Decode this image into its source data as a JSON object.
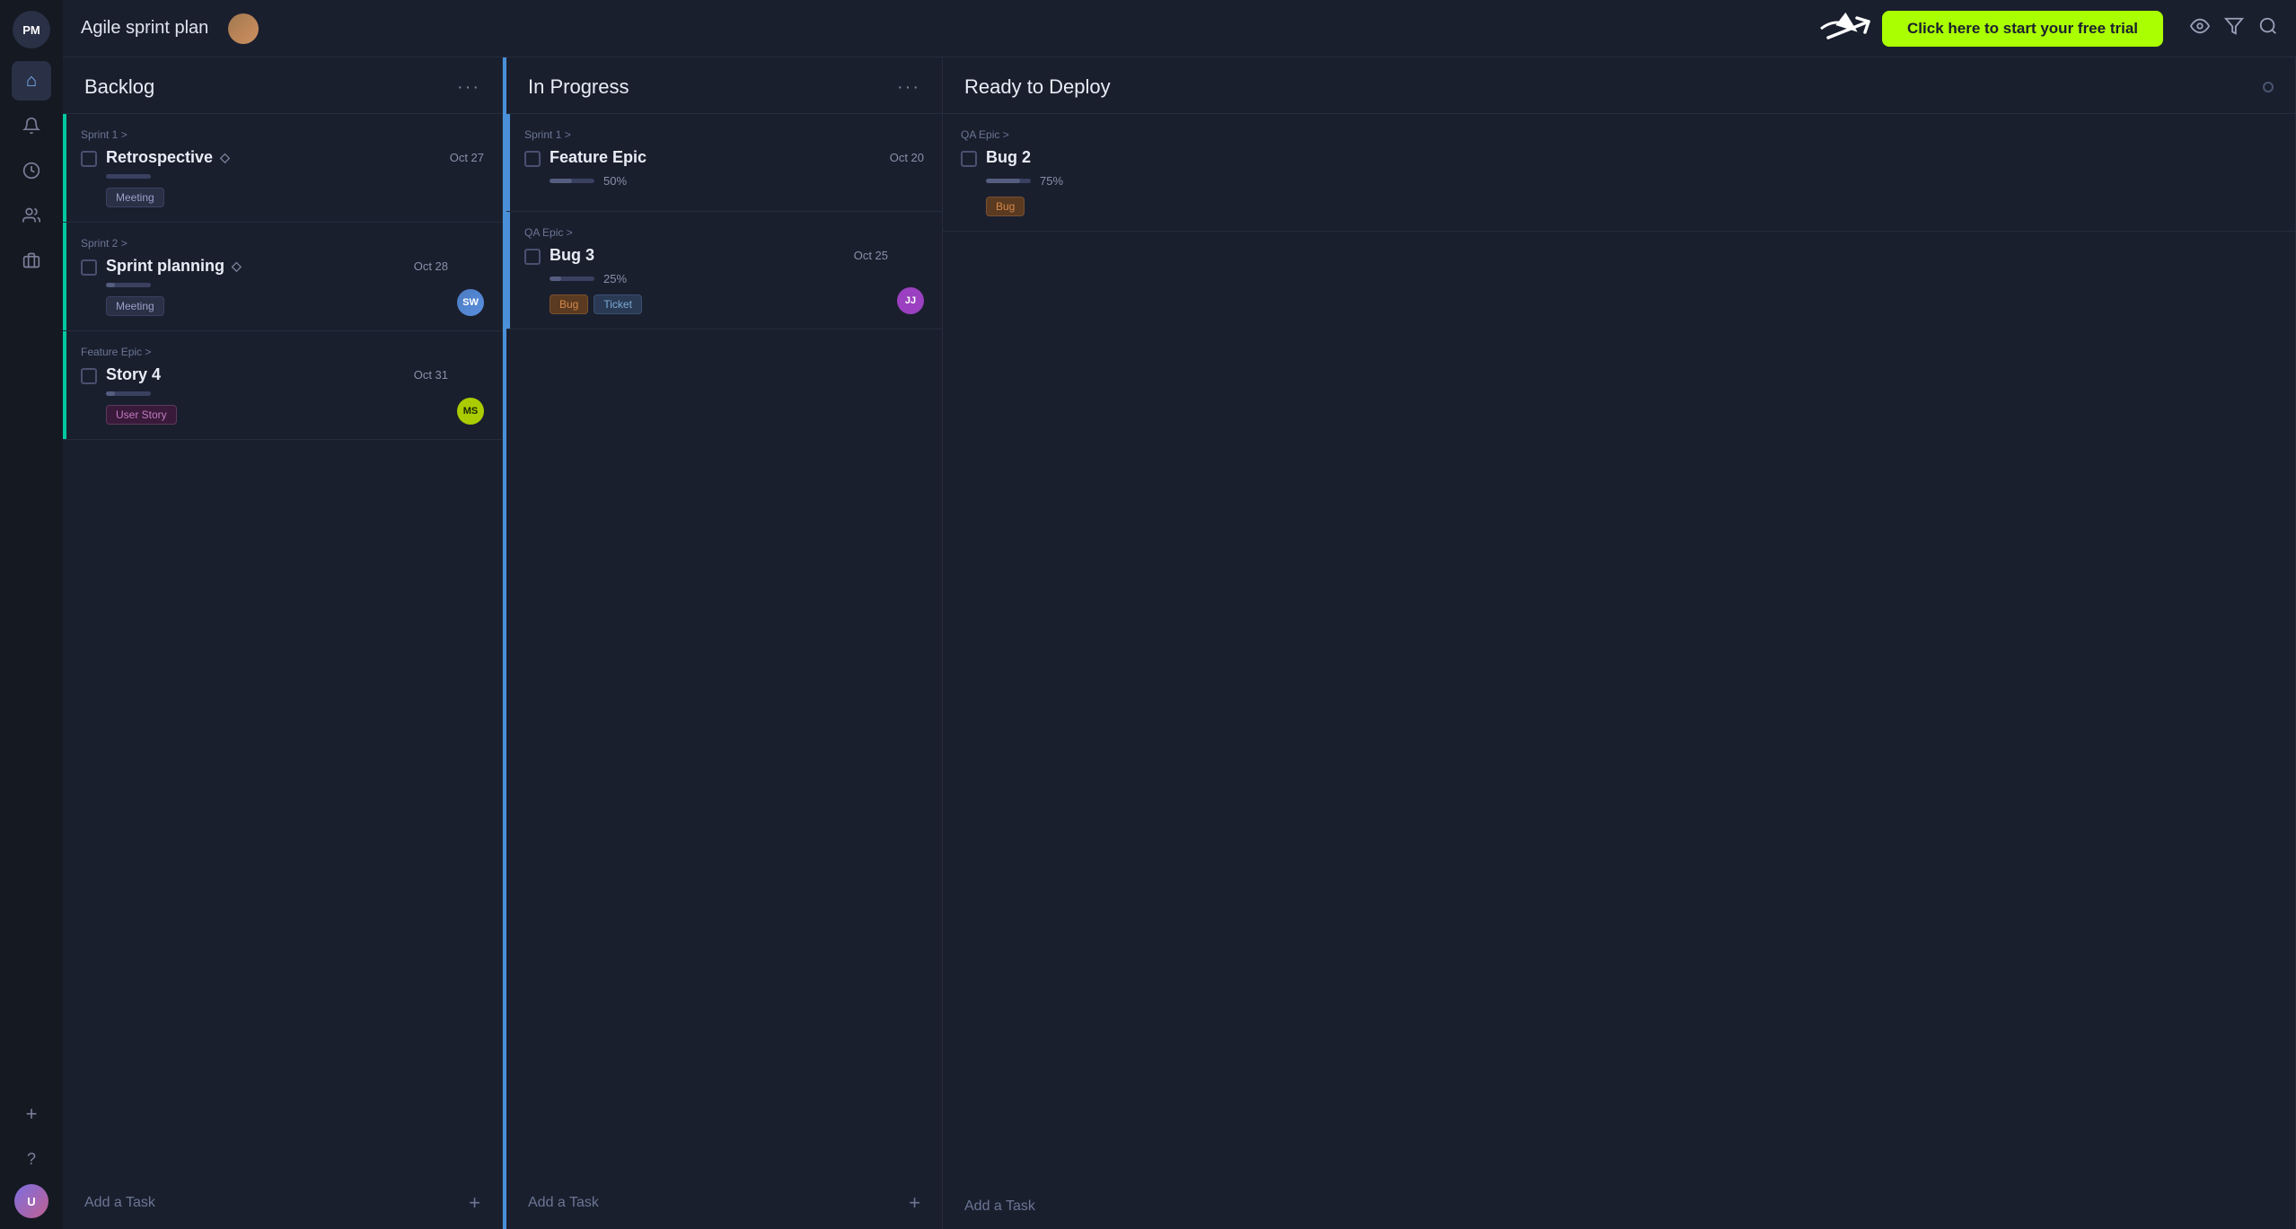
{
  "app": {
    "logo": "PM",
    "title": "Agile sprint plan"
  },
  "cta": {
    "label": "Click here to start your free trial"
  },
  "sidebar": {
    "items": [
      {
        "name": "home",
        "icon": "⌂",
        "active": true
      },
      {
        "name": "notifications",
        "icon": "🔔"
      },
      {
        "name": "clock",
        "icon": "🕐"
      },
      {
        "name": "people",
        "icon": "👤"
      },
      {
        "name": "briefcase",
        "icon": "💼"
      }
    ],
    "bottomItems": [
      {
        "name": "plus",
        "icon": "+"
      },
      {
        "name": "help",
        "icon": "?"
      }
    ],
    "avatarInitials": "U"
  },
  "topbar": {
    "icons": [
      {
        "name": "eye",
        "icon": "👁"
      },
      {
        "name": "filter",
        "icon": "⛃"
      },
      {
        "name": "search",
        "icon": "🔍"
      }
    ]
  },
  "columns": [
    {
      "id": "backlog",
      "title": "Backlog",
      "moreLabel": "···",
      "tasks": [
        {
          "id": "retrospective",
          "epic": "Sprint 1 >",
          "title": "Retrospective",
          "hasDiamond": true,
          "date": "Oct 27",
          "progress": 0,
          "progressLabel": "",
          "tags": [
            "Meeting"
          ],
          "avatar": null,
          "borderColor": "teal"
        },
        {
          "id": "sprint-planning",
          "epic": "Sprint 2 >",
          "title": "Sprint planning",
          "hasDiamond": true,
          "date": "Oct 28",
          "progress": 20,
          "progressLabel": "",
          "tags": [
            "Meeting"
          ],
          "avatar": "SW",
          "avatarClass": "avatar-sw",
          "borderColor": "teal"
        },
        {
          "id": "story-4",
          "epic": "Feature Epic >",
          "title": "Story 4",
          "hasDiamond": false,
          "date": "Oct 31",
          "progress": 20,
          "progressLabel": "",
          "tags": [
            "User Story"
          ],
          "avatar": "MS",
          "avatarClass": "avatar-ms",
          "borderColor": "teal"
        }
      ],
      "addTaskLabel": "Add a Task"
    },
    {
      "id": "in-progress",
      "title": "In Progress",
      "moreLabel": "···",
      "tasks": [
        {
          "id": "feature-epic",
          "epic": "Sprint 1 >",
          "title": "Feature Epic",
          "hasDiamond": false,
          "date": "Oct 20",
          "progress": 50,
          "progressLabel": "50%",
          "tags": [],
          "avatar": null,
          "borderColor": "blue"
        },
        {
          "id": "bug-3",
          "epic": "QA Epic >",
          "title": "Bug 3",
          "hasDiamond": false,
          "date": "Oct 25",
          "progress": 25,
          "progressLabel": "25%",
          "tags": [
            "Bug",
            "Ticket"
          ],
          "avatar": "JJ",
          "avatarClass": "avatar-jj",
          "borderColor": "blue"
        }
      ],
      "addTaskLabel": "Add a Task"
    },
    {
      "id": "ready-to-deploy",
      "title": "Ready to Deploy",
      "moreLabel": "",
      "tasks": [
        {
          "id": "bug-2",
          "epic": "QA Epic >",
          "title": "Bug 2",
          "hasDiamond": false,
          "date": "",
          "progress": 75,
          "progressLabel": "75%",
          "tags": [
            "Bug"
          ],
          "avatar": null,
          "borderColor": ""
        }
      ],
      "addTaskLabel": "Add a Task"
    }
  ]
}
